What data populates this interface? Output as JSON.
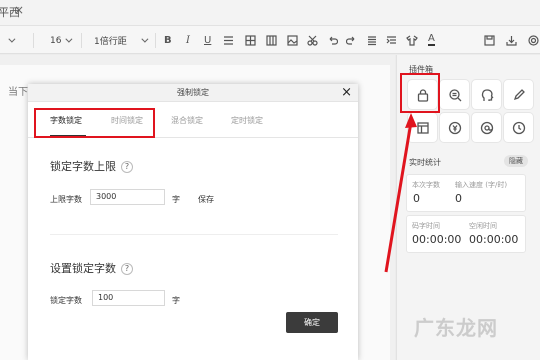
{
  "titlebar": {
    "tab": "平西",
    "close": "×"
  },
  "toolbar": {
    "font_size": "16",
    "line_spacing": "1倍行距",
    "icons": [
      "bold-icon",
      "italic-icon",
      "underline-icon",
      "align-icon",
      "table-icon",
      "grid-icon",
      "cut-icon",
      "undo-icon",
      "redo-icon",
      "list-icon",
      "indent-icon",
      "shirt-icon",
      "font-color-icon",
      "save-icon",
      "export-icon",
      "settings-icon"
    ]
  },
  "editor": {
    "text": "当下软件园"
  },
  "dialog": {
    "title": "强制锁定",
    "close": "×",
    "tabs": [
      "字数锁定",
      "时间锁定",
      "混合锁定",
      "定时锁定"
    ],
    "active_tab": 0,
    "section1": {
      "title": "锁定字数上限",
      "help": "?",
      "label": "上限字数",
      "value": "3000",
      "unit": "字",
      "save": "保存"
    },
    "section2": {
      "title": "设置锁定字数",
      "help": "?",
      "label": "锁定字数",
      "value": "100",
      "unit": "字"
    },
    "confirm": "确定"
  },
  "panel": {
    "tools_title": "插件箱",
    "tools": [
      "lock-icon",
      "search-doc-icon",
      "head-icon",
      "pen-icon",
      "table-icon",
      "yen-icon",
      "at-icon",
      "clock-icon"
    ],
    "stats_title": "实时统计",
    "hide": "隐藏",
    "this_words_label": "本次字数",
    "this_words": "0",
    "speed_label": "输入速度 (字/时)",
    "speed": "0",
    "code_time_label": "码字时间",
    "code_time": "00:00:00",
    "idle_time_label": "空闲时间",
    "idle_time": "00:00:00"
  },
  "watermark": "广东龙网",
  "colors": {
    "highlight": "#e0141e",
    "button": "#3b3b3b"
  }
}
